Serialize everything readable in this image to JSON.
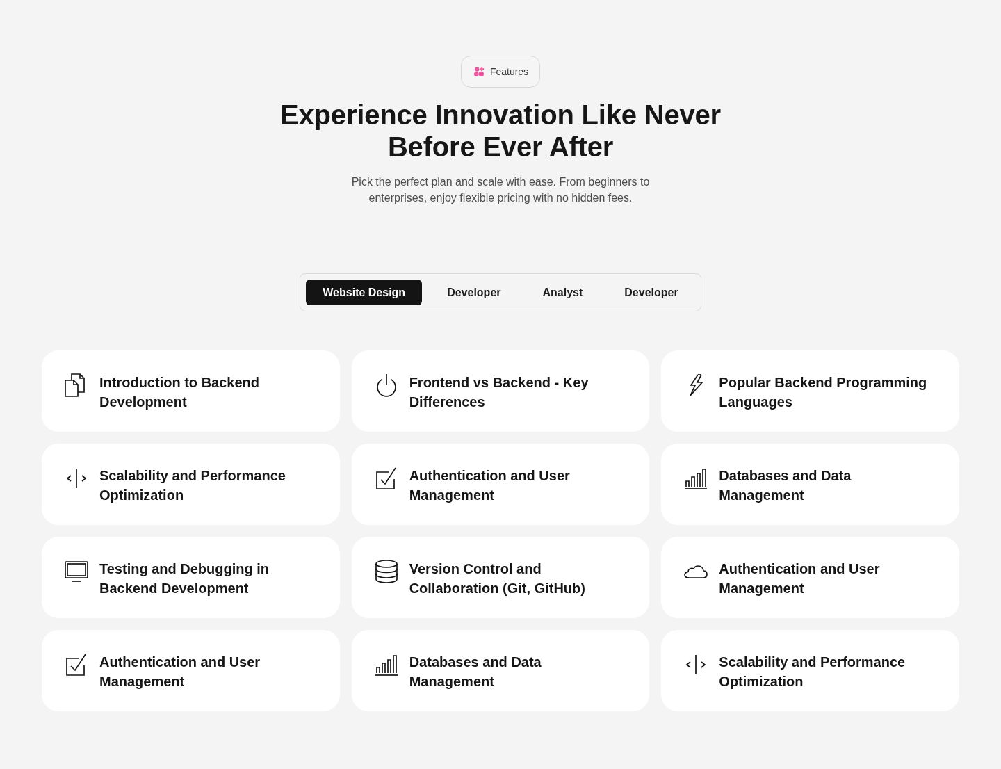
{
  "badge": {
    "label": "Features"
  },
  "heading": {
    "title": "Experience Innovation Like Never Before Ever After",
    "subtitle": "Pick the perfect plan and scale with ease. From beginners to enterprises, enjoy flexible pricing with no hidden fees."
  },
  "tabs": [
    {
      "label": "Website Design",
      "selected": true
    },
    {
      "label": "Developer",
      "selected": false
    },
    {
      "label": "Analyst",
      "selected": false
    },
    {
      "label": "Developer",
      "selected": false
    }
  ],
  "cards": [
    {
      "kind": "documents",
      "title": "Introduction to Backend Development"
    },
    {
      "kind": "power",
      "title": "Frontend vs Backend - Key Differences"
    },
    {
      "kind": "bolt",
      "title": "Popular Backend Programming Languages"
    },
    {
      "kind": "code",
      "title": "Scalability and Performance Optimization"
    },
    {
      "kind": "checkbox",
      "title": "Authentication and User Management"
    },
    {
      "kind": "chart",
      "title": "Databases and Data Management"
    },
    {
      "kind": "monitor",
      "title": "Testing and Debugging in Backend Development"
    },
    {
      "kind": "database",
      "title": "Version Control and Collaboration (Git, GitHub)"
    },
    {
      "kind": "cloud",
      "title": "Authentication and User Management"
    },
    {
      "kind": "checkbox",
      "title": "Authentication and User Management"
    },
    {
      "kind": "chart",
      "title": "Databases and Data Management"
    },
    {
      "kind": "code",
      "title": "Scalability and Performance Optimization"
    }
  ]
}
